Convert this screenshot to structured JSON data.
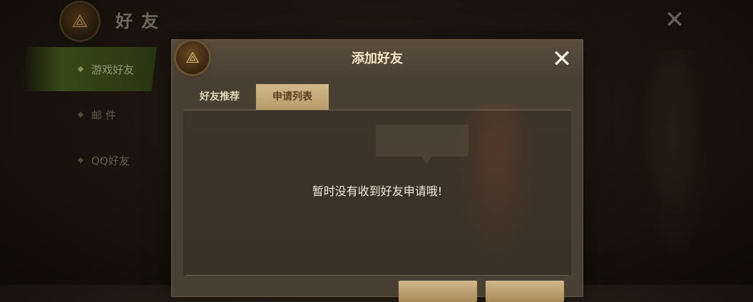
{
  "background": {
    "emblem_glyph": "⟁",
    "title": "好友",
    "close_glyph": "✕",
    "sidebar": {
      "items": [
        {
          "label": "游戏好友"
        },
        {
          "label": "邮 件"
        },
        {
          "label": "QQ好友"
        }
      ]
    }
  },
  "dialog": {
    "emblem_glyph": "⟁",
    "title": "添加好友",
    "close_glyph": "✕",
    "tabs": [
      {
        "label": "好友推荐"
      },
      {
        "label": "申请列表"
      }
    ],
    "empty_message": "暂时没有收到好友申请哦!"
  },
  "colors": {
    "accent_gold": "#d2b989",
    "active_green": "#587d26"
  }
}
